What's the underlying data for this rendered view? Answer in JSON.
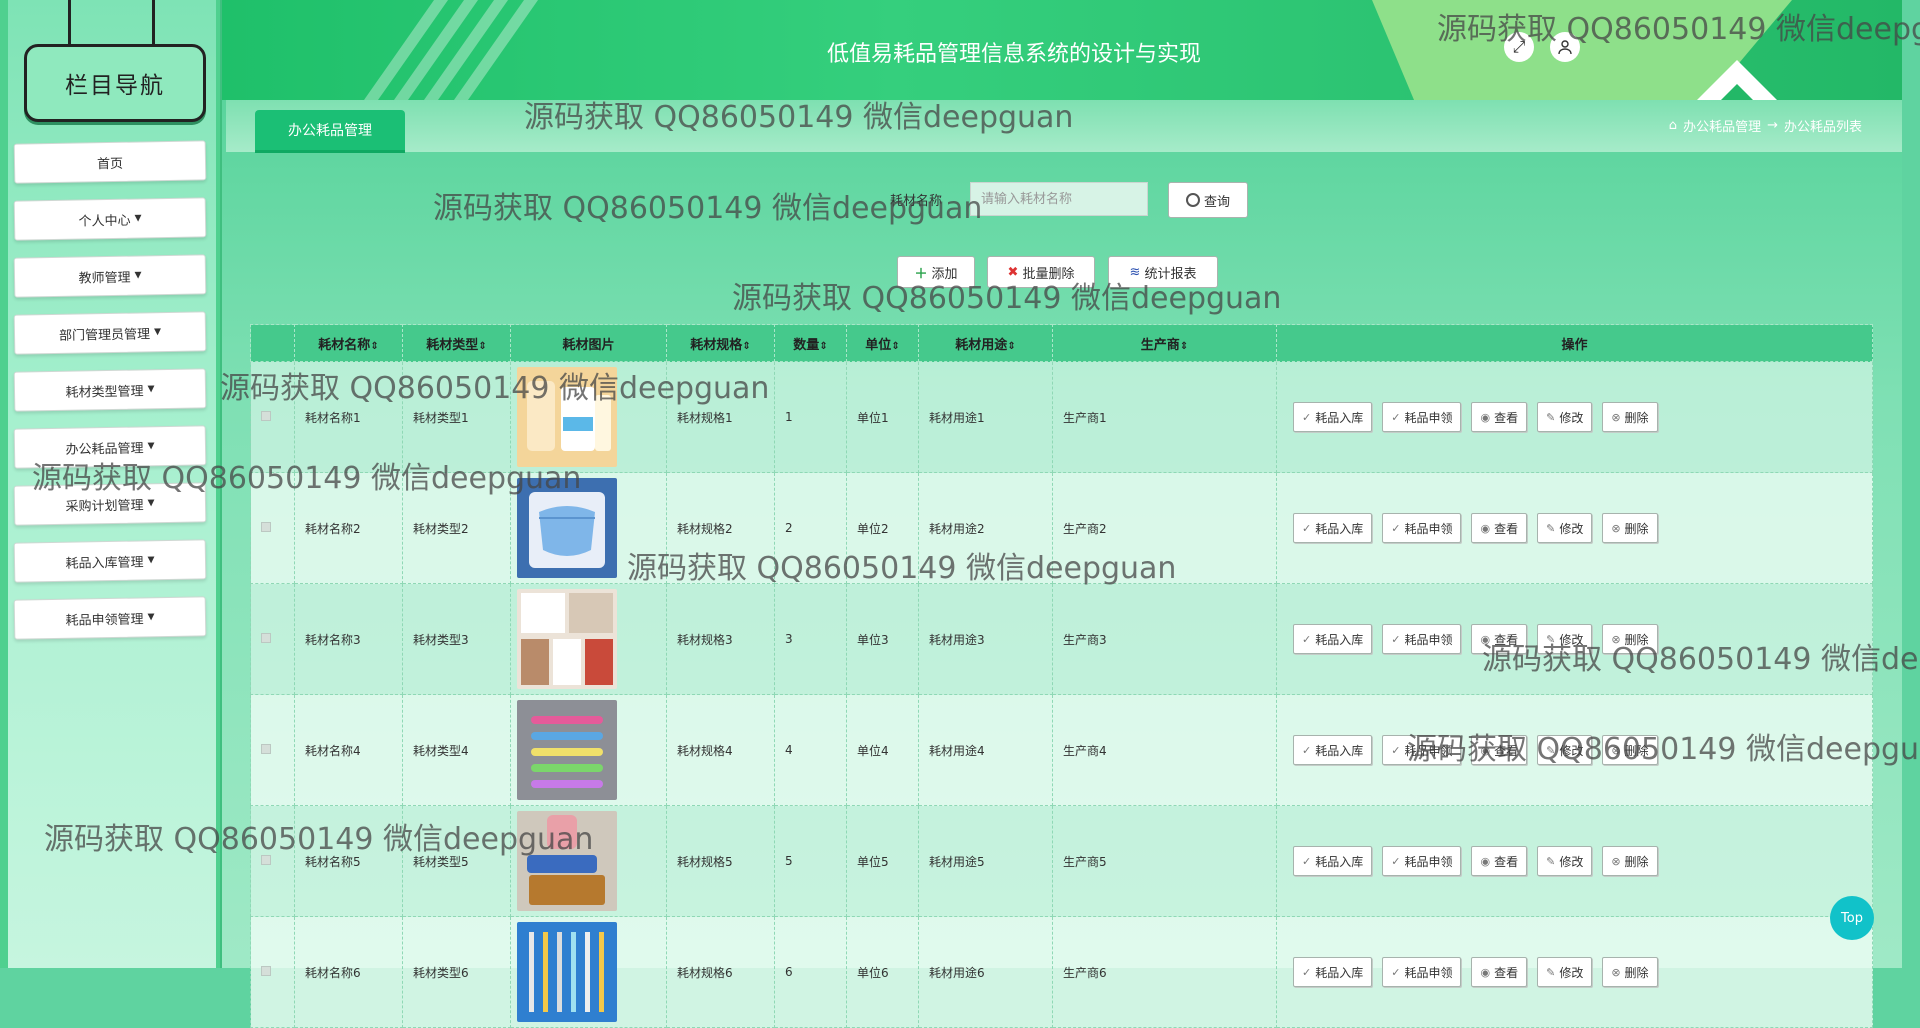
{
  "sidebar": {
    "title": "栏目导航",
    "items": [
      {
        "label": "首页",
        "has_caret": false
      },
      {
        "label": "个人中心",
        "has_caret": true
      },
      {
        "label": "教师管理",
        "has_caret": true
      },
      {
        "label": "部门管理员管理",
        "has_caret": true
      },
      {
        "label": "耗材类型管理",
        "has_caret": true
      },
      {
        "label": "办公耗品管理",
        "has_caret": true
      },
      {
        "label": "采购计划管理",
        "has_caret": true
      },
      {
        "label": "耗品入库管理",
        "has_caret": true
      },
      {
        "label": "耗品申领管理",
        "has_caret": true
      }
    ]
  },
  "header": {
    "title": "低值易耗品管理信息系统的设计与实现",
    "fullscreen_icon": "expand-icon",
    "user_icon": "user-icon"
  },
  "tab": {
    "label": "办公耗品管理"
  },
  "breadcrumb": {
    "home_icon": "home-icon",
    "level1": "办公耗品管理",
    "separator": "→",
    "level2": "办公耗品列表"
  },
  "search": {
    "label": "耗材名称",
    "placeholder": "请输入耗材名称",
    "button_label": "查询"
  },
  "actions": {
    "add": "添加",
    "batch_delete": "批量删除",
    "report": "统计报表"
  },
  "table": {
    "columns": [
      "耗材名称",
      "耗材类型",
      "耗材图片",
      "耗材规格",
      "数量",
      "单位",
      "耗材用途",
      "生产商",
      "操作"
    ],
    "sort_indicator": "⇕",
    "row_actions": [
      "耗品入库",
      "耗品申领",
      "查看",
      "修改",
      "删除"
    ],
    "rows": [
      {
        "name": "耗材名称1",
        "type": "耗材类型1",
        "image": "cotton-swabs-photo",
        "spec": "耗材规格1",
        "qty": "1",
        "unit": "单位1",
        "usage": "耗材用途1",
        "maker": "生产商1"
      },
      {
        "name": "耗材名称2",
        "type": "耗材类型2",
        "image": "face-mask-photo",
        "spec": "耗材规格2",
        "qty": "2",
        "unit": "单位2",
        "usage": "耗材用途2",
        "maker": "生产商2"
      },
      {
        "name": "耗材名称3",
        "type": "耗材类型3",
        "image": "lab-supplies-photo",
        "spec": "耗材规格3",
        "qty": "3",
        "unit": "单位3",
        "usage": "耗材用途3",
        "maker": "生产商3"
      },
      {
        "name": "耗材名称4",
        "type": "耗材类型4",
        "image": "toothbrushes-photo",
        "spec": "耗材规格4",
        "qty": "4",
        "unit": "单位4",
        "usage": "耗材用途4",
        "maker": "生产商4"
      },
      {
        "name": "耗材名称5",
        "type": "耗材类型5",
        "image": "toiletries-photo",
        "spec": "耗材规格5",
        "qty": "5",
        "unit": "单位5",
        "usage": "耗材用途5",
        "maker": "生产商5"
      },
      {
        "name": "耗材名称6",
        "type": "耗材类型6",
        "image": "tools-photo",
        "spec": "耗材规格6",
        "qty": "6",
        "unit": "单位6",
        "usage": "耗材用途6",
        "maker": "生产商6"
      }
    ]
  },
  "top_button": "Top",
  "watermark_text": "源码获取 QQ86050149 微信deepguan",
  "colors": {
    "brand_green": "#1bbf75",
    "header_green": "#2cc873",
    "top_button": "#11c2c9"
  }
}
